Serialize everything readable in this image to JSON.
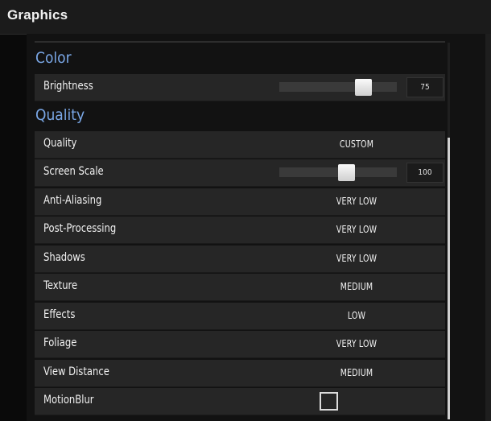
{
  "window": {
    "title": "Graphics"
  },
  "sections": {
    "color": "Color",
    "quality": "Quality"
  },
  "settings": {
    "brightness": {
      "label": "Brightness",
      "value": "75",
      "fraction": 0.75
    },
    "quality": {
      "label": "Quality",
      "value": "CUSTOM"
    },
    "screen_scale": {
      "label": "Screen Scale",
      "value": "100",
      "fraction": 0.58
    },
    "anti_aliasing": {
      "label": "Anti-Aliasing",
      "value": "VERY LOW"
    },
    "post_processing": {
      "label": "Post-Processing",
      "value": "VERY LOW"
    },
    "shadows": {
      "label": "Shadows",
      "value": "VERY LOW"
    },
    "texture": {
      "label": "Texture",
      "value": "MEDIUM"
    },
    "effects": {
      "label": "Effects",
      "value": "LOW"
    },
    "foliage": {
      "label": "Foliage",
      "value": "VERY LOW"
    },
    "view_distance": {
      "label": "View Distance",
      "value": "MEDIUM"
    },
    "motion_blur": {
      "label": "MotionBlur",
      "checked": false
    }
  },
  "colors": {
    "section_header": "#7aa7e6",
    "row_bg": "#262626",
    "background": "#0a0a0a"
  }
}
